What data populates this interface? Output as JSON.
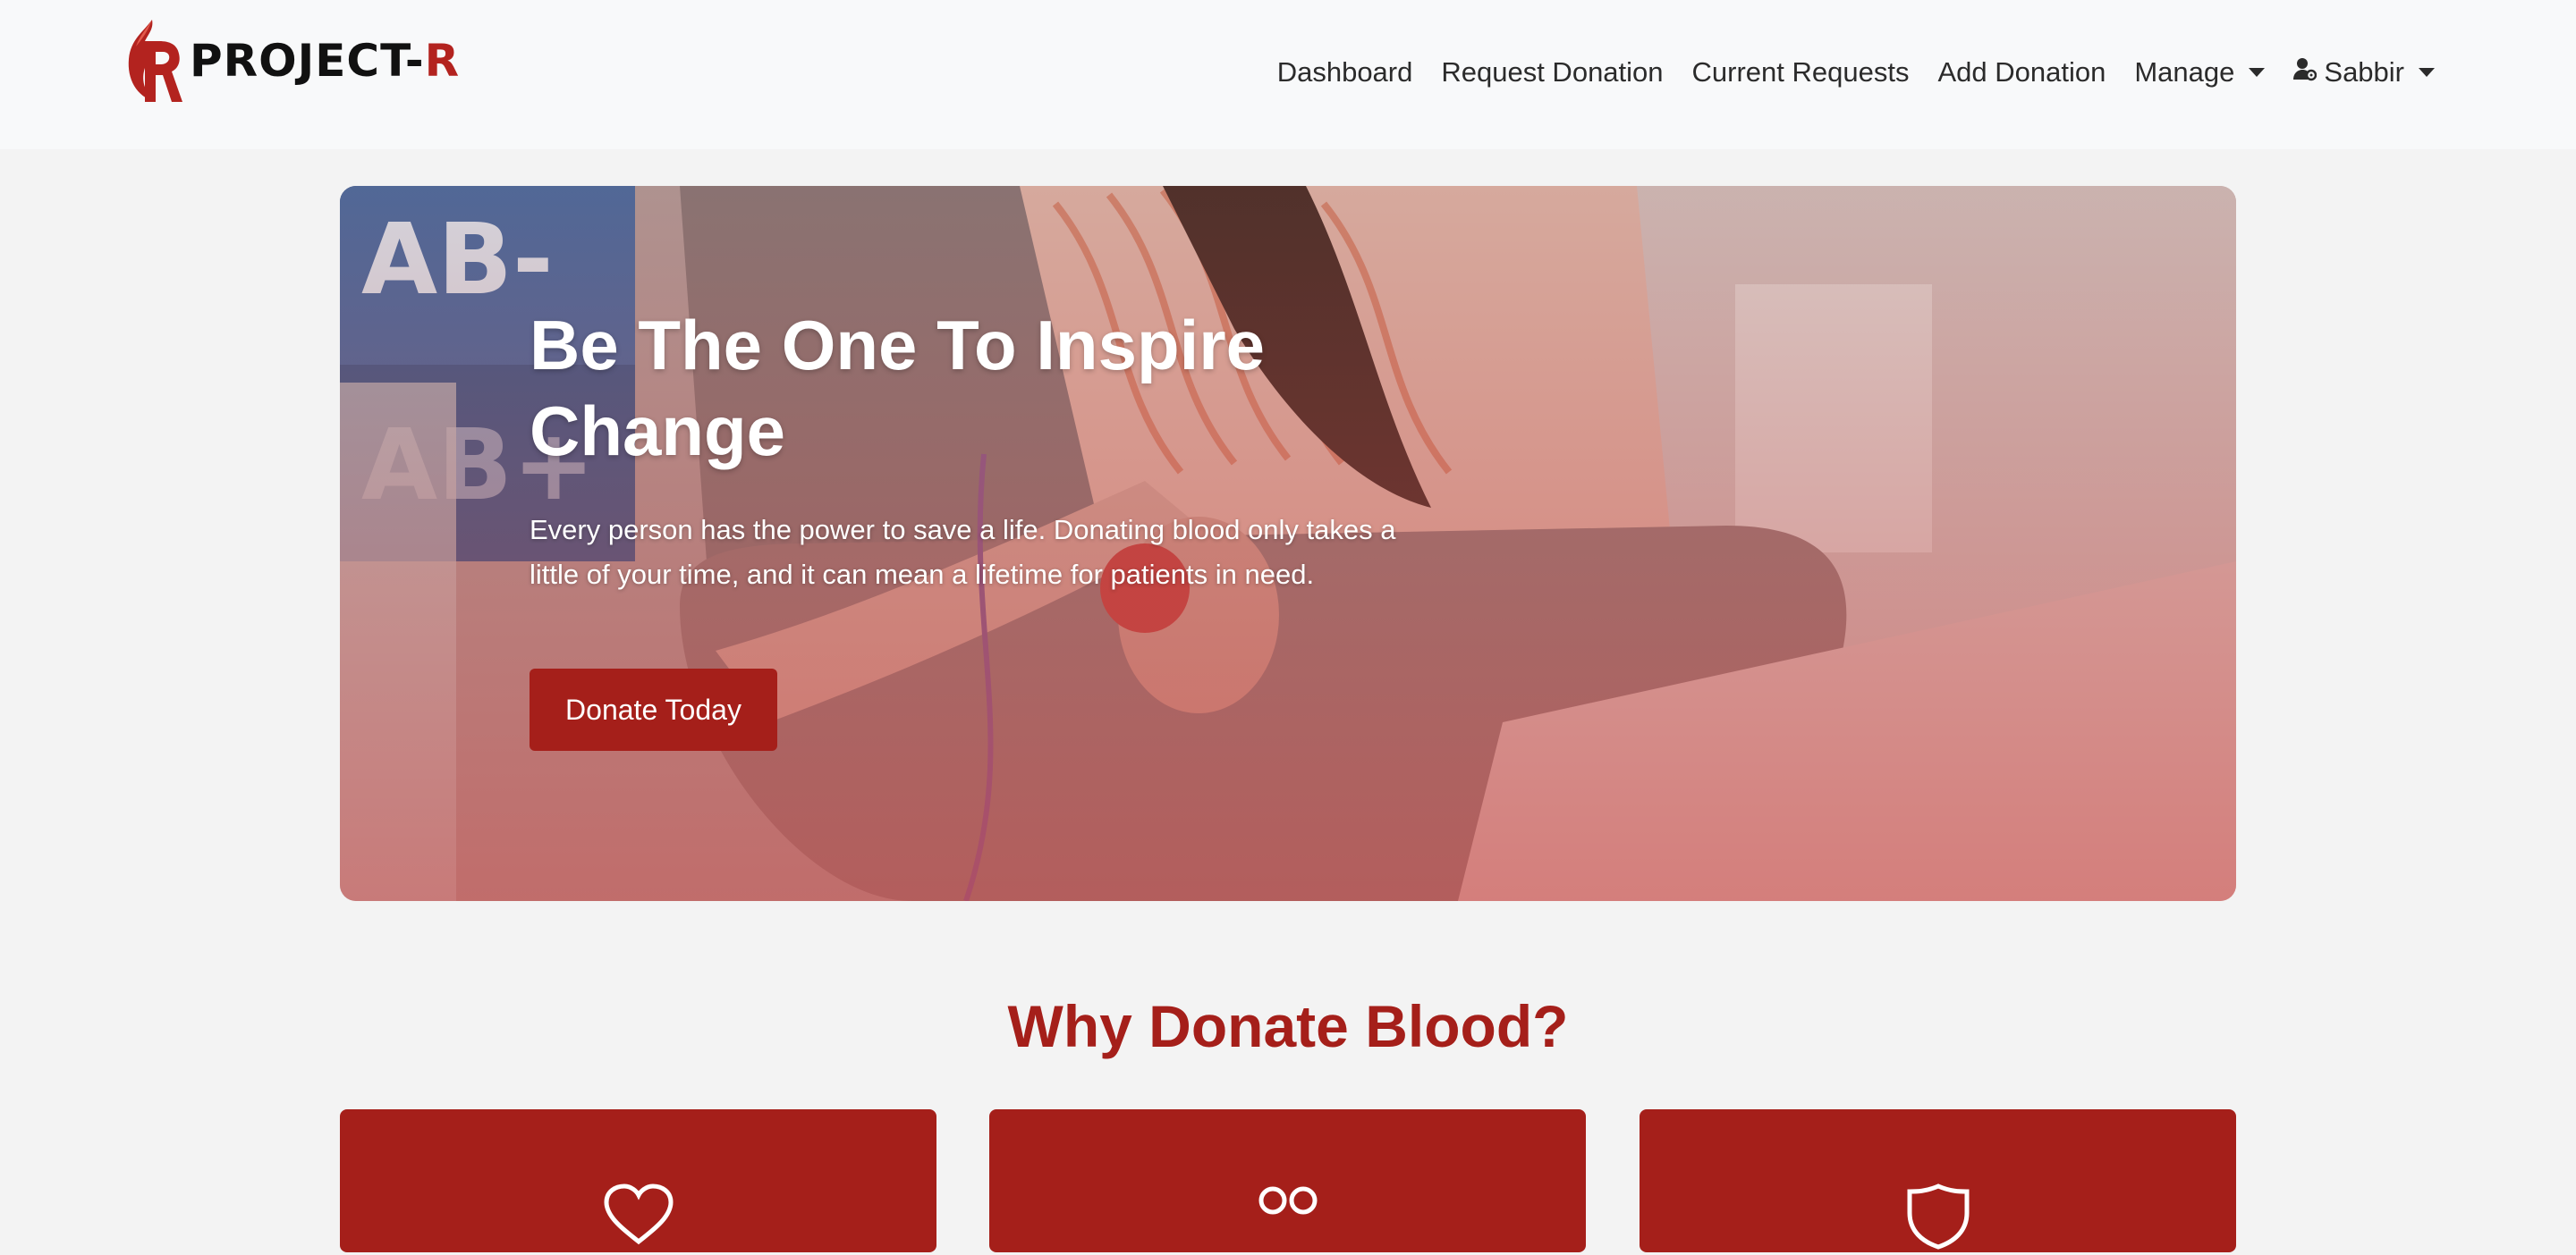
{
  "brand": {
    "name_main": "PROJECT-",
    "name_accent": "R",
    "logo_icon": "project-r-logo"
  },
  "nav": {
    "items": [
      {
        "label": "Dashboard"
      },
      {
        "label": "Request Donation"
      },
      {
        "label": "Current Requests"
      },
      {
        "label": "Add Donation"
      },
      {
        "label": "Manage",
        "dropdown": true
      },
      {
        "label": "Sabbir",
        "dropdown": true,
        "icon": "user-gear-icon"
      }
    ]
  },
  "hero": {
    "title_line1": "Be The One To Inspire",
    "title_line2": "Change",
    "text": "Every person has the power to save a life. Donating blood only takes a little of your time, and it can mean a lifetime for patients in need.",
    "button_label": "Donate Today",
    "background_labels": [
      "AB-",
      "AB+"
    ]
  },
  "why": {
    "title": "Why Donate Blood?",
    "cards": [
      {
        "icon": "heart-icon"
      },
      {
        "icon": "people-icon"
      },
      {
        "icon": "shield-icon"
      }
    ]
  },
  "colors": {
    "accent": "#a51f1a",
    "navbar_bg": "#f8f9fa",
    "page_bg": "#f3f3f3"
  }
}
